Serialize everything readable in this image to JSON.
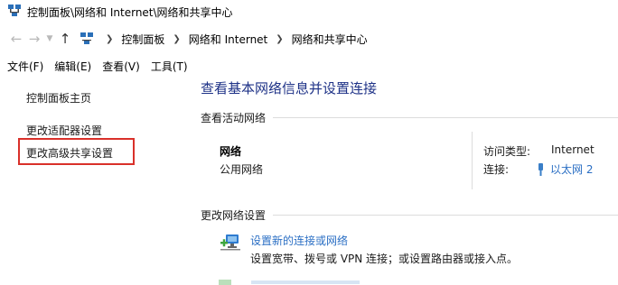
{
  "window": {
    "title": "控制面板\\网络和 Internet\\网络和共享中心",
    "icon": "network-sharing-center-icon"
  },
  "nav": {
    "back_icon": "arrow-left-icon",
    "forward_icon": "arrow-right-icon",
    "recent_icon": "chevron-down-icon",
    "up_icon": "arrow-up-icon"
  },
  "breadcrumb": [
    {
      "label": "控制面板"
    },
    {
      "label": "网络和 Internet"
    },
    {
      "label": "网络和共享中心"
    }
  ],
  "menubar": [
    {
      "label": "文件(F)"
    },
    {
      "label": "编辑(E)"
    },
    {
      "label": "查看(V)"
    },
    {
      "label": "工具(T)"
    }
  ],
  "sidebar": {
    "items": [
      {
        "label": "控制面板主页"
      },
      {
        "label": "更改适配器设置"
      },
      {
        "label": "更改高级共享设置",
        "highlighted": true
      }
    ],
    "highlight_color": "#d9302a"
  },
  "main": {
    "title": "查看基本网络信息并设置连接",
    "active_section": "查看活动网络",
    "network": {
      "name": "网络",
      "type": "公用网络",
      "access_label": "访问类型:",
      "access_value": "Internet",
      "connection_label": "连接:",
      "connection_value": "以太网 2"
    },
    "settings_section": "更改网络设置",
    "task": {
      "link": "设置新的连接或网络",
      "desc": "设置宽带、拨号或 VPN 连接；或设置路由器或接入点。"
    }
  },
  "colors": {
    "title": "#1e3287",
    "link": "#2b6fc4"
  }
}
